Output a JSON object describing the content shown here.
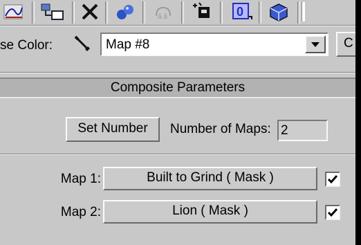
{
  "toolbar": {
    "icons": [
      "curve-graph-icon",
      "hierarchy-icon",
      "delete-x-icon",
      "spheres-icon",
      "material-effects-icon",
      "put-to-library-icon",
      "material-id-channel-icon",
      "show-map-in-viewport-icon"
    ]
  },
  "material": {
    "color_label": "se Color:",
    "map_name": "Map #8",
    "right_button_label": "C"
  },
  "rollout": {
    "title": "Composite Parameters"
  },
  "composite": {
    "set_number_label": "Set Number",
    "number_of_maps_label": "Number of Maps:",
    "number_of_maps_value": "2"
  },
  "maps": [
    {
      "label": "Map 1:",
      "name": "Built to Grind  ( Mask )",
      "checked": true
    },
    {
      "label": "Map 2:",
      "name": "Lion  ( Mask )",
      "checked": true
    }
  ],
  "colors": {
    "panel": "#c8c8c8",
    "header": "#b2b2b2",
    "accent_blue": "#2040c0"
  }
}
